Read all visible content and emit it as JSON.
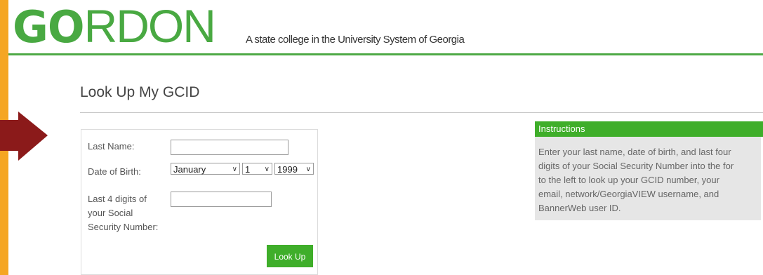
{
  "header": {
    "logo_part1": "GO",
    "logo_part2": "RDON",
    "tagline": "A state college in the University System of Georgia"
  },
  "page": {
    "title": "Look Up My GCID"
  },
  "form": {
    "last_name_label": "Last Name:",
    "last_name_value": "",
    "dob_label": "Date of Birth:",
    "dob_month": "January",
    "dob_day": "1",
    "dob_year": "1999",
    "ssn_label": "Last 4 digits of your Social Security Number:",
    "ssn_value": "",
    "submit_label": "Look Up"
  },
  "instructions": {
    "heading": "Instructions",
    "lines": [
      "Enter your last name, date of birth, and last four",
      "digits of your Social Security Number into the for",
      "to the left to look up your GCID number, your",
      "email, network/GeorgiaVIEW username, and",
      "BannerWeb user ID."
    ]
  },
  "colors": {
    "brand_green": "#49a942",
    "button_green": "#3fae2a",
    "frame_orange": "#f5a623",
    "arrow_red": "#8b1a1a"
  },
  "icons": {
    "annotation_arrow": "arrow-right-icon",
    "select_chevron": "chevron-down-icon"
  }
}
